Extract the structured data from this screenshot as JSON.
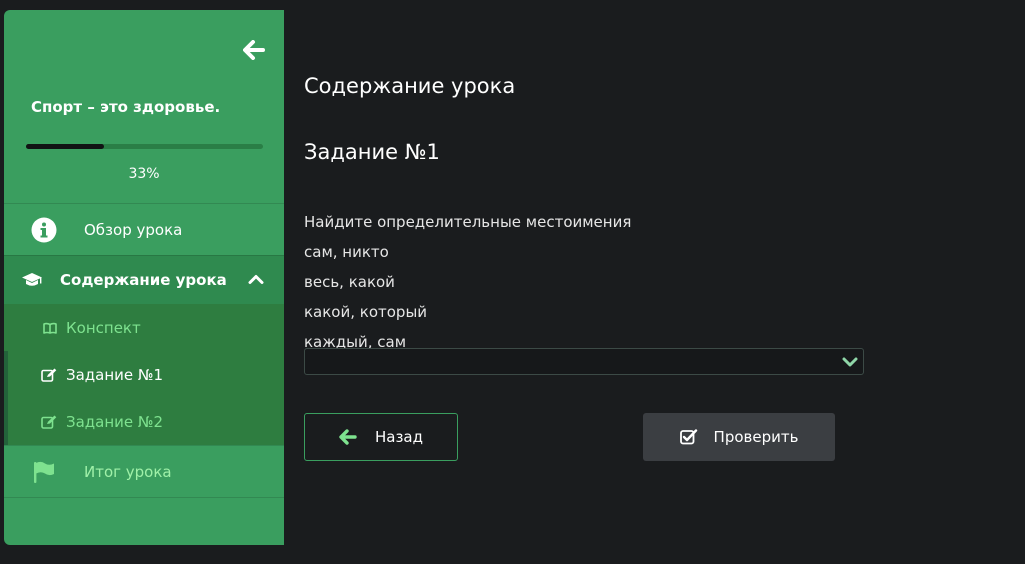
{
  "sidebar": {
    "course_title": "Спорт – это здоровье.",
    "progress": {
      "percent": 33,
      "label": "33%"
    },
    "nav": {
      "overview": {
        "label": "Обзор урока",
        "icon": "info-circle-icon"
      },
      "content": {
        "label": "Содержание урока",
        "icon": "graduation-cap-icon",
        "expanded": true,
        "items": [
          {
            "label": "Конспект",
            "icon": "book-open-icon"
          },
          {
            "label": "Задание №1",
            "icon": "edit-icon",
            "active": true
          },
          {
            "label": "Задание №2",
            "icon": "edit-icon"
          }
        ]
      },
      "result": {
        "label": "Итог урока",
        "icon": "flag-icon"
      }
    }
  },
  "main": {
    "heading": "Содержание урока",
    "task_title": "Задание №1",
    "question": {
      "prompt": "Найдите определительные местоимения",
      "options": [
        "сам, никто",
        "весь, какой",
        "какой, который",
        "каждый, сам"
      ]
    },
    "answer_select": {
      "value": ""
    },
    "buttons": {
      "back": "Назад",
      "check": "Проверить"
    }
  },
  "colors": {
    "sidebar_green": "#3a9e5f",
    "submenu_green": "#2e7d40",
    "accent_text_green": "#7ee28f",
    "background": "#1a1c1e",
    "check_button": "#3b3e42"
  }
}
